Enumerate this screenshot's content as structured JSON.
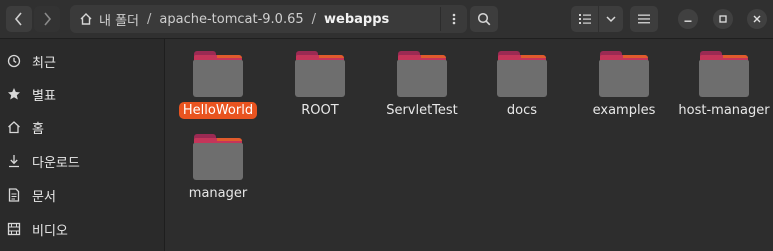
{
  "path": {
    "crumbs": [
      "내 폴더",
      "apache-tomcat-9.0.65",
      "webapps"
    ],
    "separator": "/"
  },
  "sidebar": {
    "items": [
      {
        "label": "최근",
        "icon": "clock-icon"
      },
      {
        "label": "별표",
        "icon": "star-icon"
      },
      {
        "label": "홈",
        "icon": "home-icon"
      },
      {
        "label": "다운로드",
        "icon": "download-icon"
      },
      {
        "label": "문서",
        "icon": "document-icon"
      },
      {
        "label": "비디오",
        "icon": "video-icon"
      }
    ]
  },
  "files": [
    {
      "name": "HelloWorld",
      "selected": true
    },
    {
      "name": "ROOT"
    },
    {
      "name": "ServletTest"
    },
    {
      "name": "docs"
    },
    {
      "name": "examples"
    },
    {
      "name": "host-manager"
    },
    {
      "name": "manager"
    }
  ],
  "colors": {
    "accent": "#e95420",
    "folder_back": "#c4355a",
    "folder_front": "#6e6e6e"
  }
}
